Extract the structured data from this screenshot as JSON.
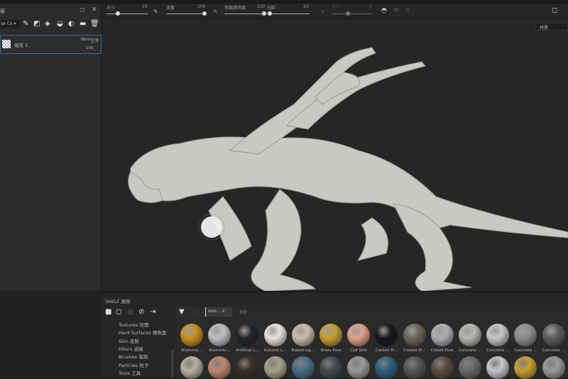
{
  "layers_panel": {
    "title": "层",
    "blend_mode": "se Co",
    "layer": {
      "name": "填充 1",
      "blend": "Norm",
      "blend_cn": "正常",
      "opacity": "100"
    }
  },
  "toolbar": {
    "size_label": "大小",
    "size_value": "10",
    "flow_label": "流量",
    "flow_value": "100",
    "stroke_opacity_label": "笔触透明度",
    "stroke_opacity_value": "100",
    "spacing_label": "间距",
    "spacing_value": "20",
    "jitter_label": "0.0",
    "jitter_value": "0"
  },
  "viewport": {
    "display_mode": "材质"
  },
  "shelf": {
    "title": "SHELF 展架",
    "filter_tag": "Refe...",
    "search_placeholder": "搜索",
    "categories": [
      "Textures 纹理",
      "Hard Surfaces 硬表面",
      "Skin 皮肤",
      "Filters 滤镜",
      "Brushes 笔刷",
      "Particles 粒子",
      "Tools 工具"
    ],
    "materials_row1": [
      {
        "name": "Aluminiu...",
        "color": "#c8901c"
      },
      {
        "name": "Aluminiu...",
        "color": "#c0c0c4"
      },
      {
        "name": "Artificial L...",
        "color": "#22252a"
      },
      {
        "name": "Autumn L...",
        "color": "#e8e4e0"
      },
      {
        "name": "Baked Lig...",
        "color": "#cdbba8"
      },
      {
        "name": "Brass Pure",
        "color": "#c8a030"
      },
      {
        "name": "Calf Skin",
        "color": "#e0a088"
      },
      {
        "name": "Carbon Fi...",
        "color": "#15171a"
      },
      {
        "name": "Coated M...",
        "color": "#6a6858"
      },
      {
        "name": "Cobalt Pure",
        "color": "#b0b0b4"
      },
      {
        "name": "Concrete ...",
        "color": "#b8b6b0"
      },
      {
        "name": "Concrete ...",
        "color": "#c6c6c8"
      },
      {
        "name": "Concrete ...",
        "color": "#8e8e90"
      },
      {
        "name": "Concrete ...",
        "color": "#5e5e60"
      }
    ],
    "materials_row2": [
      "#b8b29a",
      "#c08870",
      "#3a3028",
      "#a8a488",
      "#4a7088",
      "#444a50",
      "#9a9a9a",
      "#2e6080",
      "#555555",
      "#5e4a40",
      "#6a6a6c",
      "#c8c8cc",
      "#c8a030",
      "#9a9a98"
    ]
  }
}
